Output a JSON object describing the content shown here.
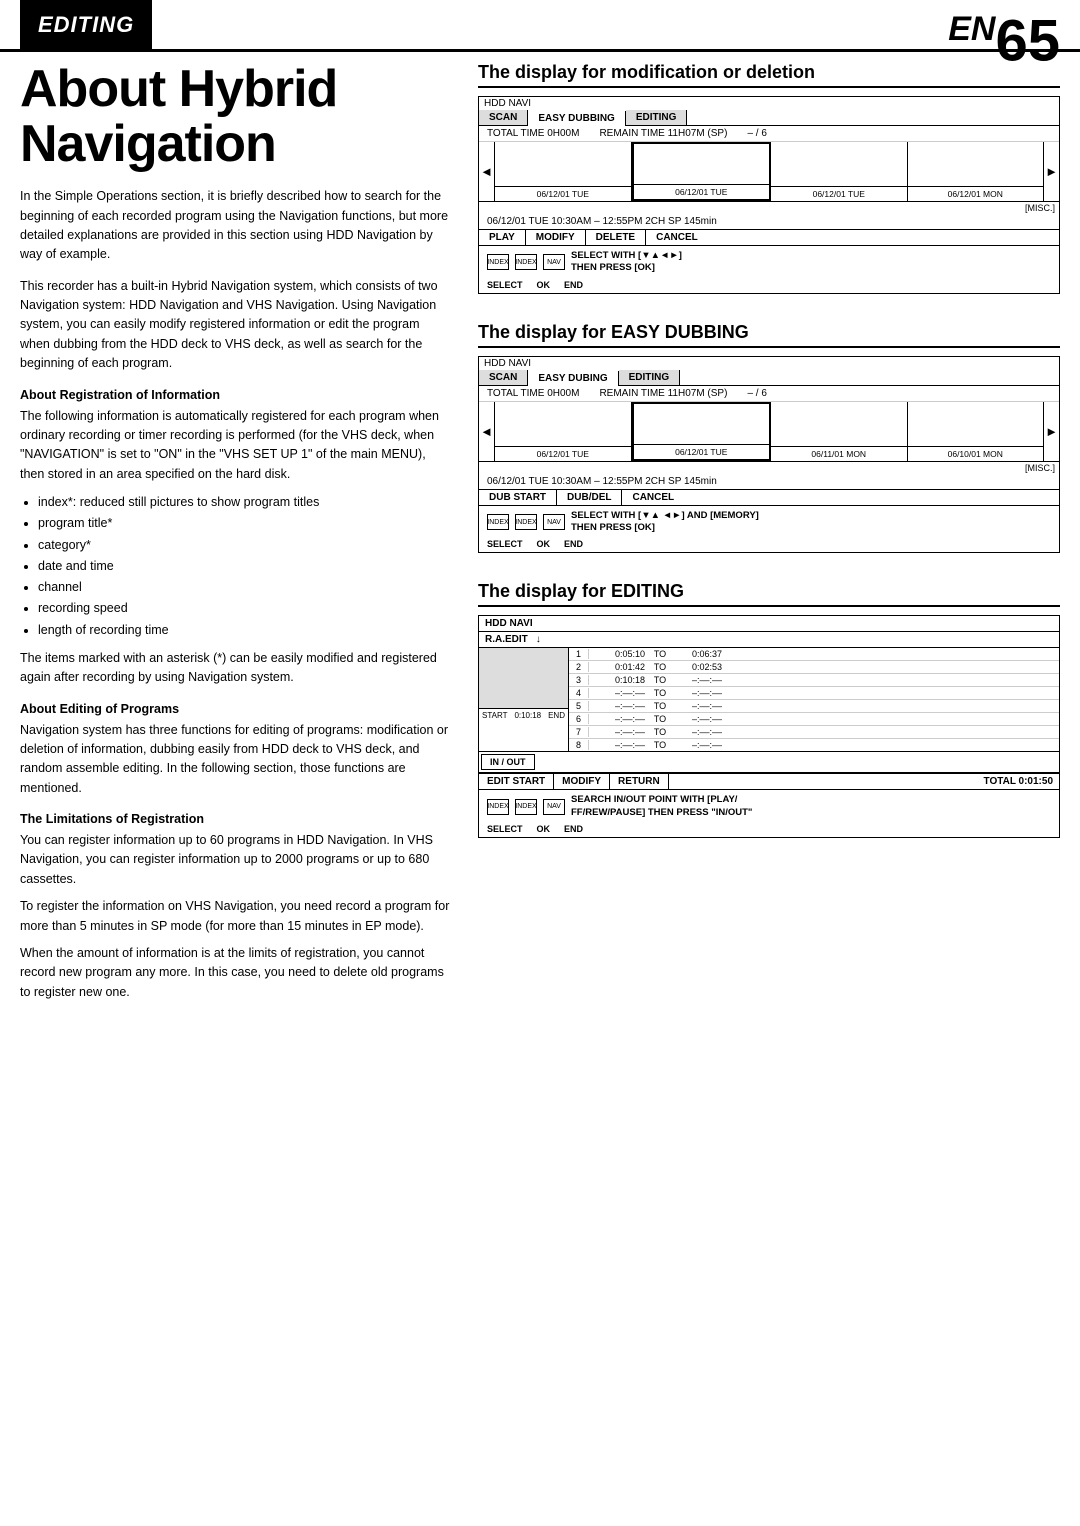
{
  "header": {
    "editing_label": "EDITING",
    "en_prefix": "EN",
    "page_number": "65"
  },
  "main_title": {
    "line1": "About Hybrid",
    "line2": "Navigation"
  },
  "intro_paragraphs": [
    "In the Simple Operations section, it is briefly described how to search for the beginning of each recorded program using the Navigation functions, but more detailed explanations are provided in this section using HDD Navigation by way of example.",
    "This recorder has a built-in Hybrid Navigation system, which consists of two Navigation system: HDD Navigation and VHS Navigation. Using Navigation system, you can easily modify registered information or edit the program when dubbing from the HDD deck to VHS deck, as well as search for the beginning of each program."
  ],
  "sections": [
    {
      "heading": "About Registration of Information",
      "paragraphs": [
        "The following information is automatically registered for each program when ordinary recording or timer recording is performed (for the VHS deck, when \"NAVIGATION\" is set to \"ON\" in the \"VHS SET UP 1\" of the main MENU), then stored in an area specified on the hard disk."
      ],
      "bullets": [
        "index*: reduced still pictures to show program titles",
        "program title*",
        "category*",
        "date and time",
        "channel",
        "recording speed",
        "length of recording time"
      ],
      "after_bullets": "The items marked with an asterisk (*) can be easily modified and registered again after recording by using Navigation system."
    },
    {
      "heading": "About Editing of Programs",
      "paragraphs": [
        "Navigation system has three functions for editing of programs: modification or deletion of information, dubbing easily from HDD deck to VHS deck, and random assemble editing. In the following section, those functions are mentioned."
      ]
    },
    {
      "heading": "The Limitations of Registration",
      "paragraphs": [
        "You can register information up to 60 programs in HDD Navigation. In VHS Navigation, you can register information up to 2000 programs or up to 680 cassettes.",
        "To register the information on VHS Navigation, you need record a program for more than 5 minutes in SP mode (for more than 15 minutes in EP mode).",
        "When the amount of information is at the limits of registration, you cannot record new program any more. In this case, you need to delete old programs to register new one."
      ]
    }
  ],
  "display_mod_deletion": {
    "title": "The display for modification or deletion",
    "hdd_label": "HDD NAVI",
    "tabs": [
      "SCAN",
      "EASY DUBBING",
      "EDITING"
    ],
    "active_tab": "EASY DUBBING",
    "total_time": "TOTAL TIME  0H00M",
    "remain_time": "REMAIN TIME 11H07M (SP)",
    "remain_count": "– / 6",
    "arrow_left": "◄",
    "arrow_right": "►",
    "thumbnails": [
      {
        "date": "06/12/01 TUE",
        "selected": false
      },
      {
        "date": "06/12/01 TUE",
        "selected": true
      },
      {
        "date": "06/12/01 TUE",
        "selected": false
      },
      {
        "date": "06/12/01 MON",
        "selected": false
      }
    ],
    "misc_label": "[MISC.]",
    "info_line": "06/12/01 TUE 10:30AM – 12:55PM  2CH  SP  145min",
    "buttons": [
      "PLAY",
      "MODIFY",
      "DELETE",
      "CANCEL"
    ],
    "controls_icons": [
      "INDEX",
      "INDEX",
      "NAV"
    ],
    "controls_text": "SELECT WITH [▼▲◄►]\nTHEN PRESS  [OK]",
    "controls_labels": [
      "SELECT",
      "OK",
      "END"
    ]
  },
  "display_easy_dubbing": {
    "title": "The display for EASY DUBBING",
    "hdd_label": "HDD NAVI",
    "tabs": [
      "SCAN",
      "EASY DUBING",
      "EDITING"
    ],
    "active_tab": "EASY DUBING",
    "total_time": "TOTAL TIME  0H00M",
    "remain_time": "REMAIN TIME 11H07M (SP)",
    "remain_count": "– / 6",
    "thumbnails": [
      {
        "date": "06/12/01 TUE",
        "selected": false
      },
      {
        "date": "06/12/01 TUE",
        "selected": true
      },
      {
        "date": "06/11/01 MON",
        "selected": false
      },
      {
        "date": "06/10/01 MON",
        "selected": false
      }
    ],
    "misc_label": "[MISC.]",
    "info_line": "06/12/01 TUE 10:30AM – 12:55PM  2CH  SP  145min",
    "buttons": [
      "DUB START",
      "DUB/DEL",
      "CANCEL"
    ],
    "controls_text": "SELECT WITH [▼▲ ◄►] AND [MEMORY]\nTHEN PRESS  [OK]",
    "controls_labels": [
      "SELECT",
      "OK",
      "END"
    ]
  },
  "display_editing": {
    "title": "The display for EDITING",
    "hdd_label": "HDD NAVI",
    "ra_edit_label": "R.A.EDIT",
    "arrow_label": "↓",
    "rows": [
      {
        "num": "1",
        "in": "0:05:10",
        "to": "TO",
        "out": "0:06:37"
      },
      {
        "num": "2",
        "in": "0:01:42",
        "to": "TO",
        "out": "0:02:53"
      },
      {
        "num": "3",
        "in": "0:10:18",
        "to": "TO",
        "out": "–:––:––"
      },
      {
        "num": "4",
        "in": "–:––:––",
        "to": "TO",
        "out": "–:––:––"
      },
      {
        "num": "5",
        "in": "–:––:––",
        "to": "TO",
        "out": "–:––:––"
      },
      {
        "num": "6",
        "in": "–:––:––",
        "to": "TO",
        "out": "–:––:––"
      },
      {
        "num": "7",
        "in": "–:––:––",
        "to": "TO",
        "out": "–:––:––"
      },
      {
        "num": "8",
        "in": "–:––:––",
        "to": "TO",
        "out": "–:––:––"
      }
    ],
    "start_label": "START",
    "start_time": "0:10:18",
    "end_label": "END",
    "in_out_btn": "IN / OUT",
    "buttons": [
      "EDIT START",
      "MODIFY",
      "RETURN"
    ],
    "total_label": "TOTAL 0:01:50",
    "controls_text": "SEARCH IN/OUT POINT WITH [PLAY/\nFF/REW/PAUSE] THEN PRESS \"IN/OUT\"",
    "controls_labels": [
      "SELECT",
      "OK",
      "END"
    ]
  }
}
